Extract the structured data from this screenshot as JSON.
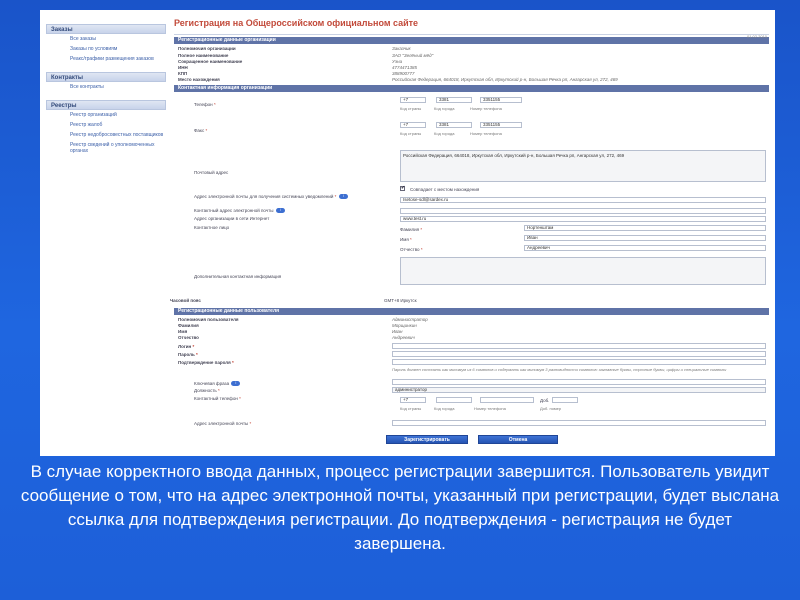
{
  "sidebar": {
    "sections": [
      {
        "title": "Заказы",
        "items": [
          "Все заказы",
          "Заказы по условиям",
          "Реакс/графики размещения заказов"
        ]
      },
      {
        "title": "Контракты",
        "items": [
          "Все контракты"
        ]
      },
      {
        "title": "Реестры",
        "items": [
          "Реестр организаций",
          "Реестр жалоб",
          "Реестр недобросовестных поставщиков",
          "Реестр сведений о уполномоченных органах"
        ]
      }
    ]
  },
  "page": {
    "title": "Регистрация на Общероссийском официальном сайте",
    "date": "01.02.2010"
  },
  "org_section": {
    "header": "Регистрационные данные организации",
    "rows": [
      {
        "label": "Полномочия организации",
        "value": "Заказчик"
      },
      {
        "label": "Полное наименование",
        "value": "ЗАО \"Зелёный мёд\""
      },
      {
        "label": "Сокращенное наименование",
        "value": "Уэна"
      },
      {
        "label": "ИНН",
        "value": "4774471385"
      },
      {
        "label": "КПП",
        "value": "388900777"
      },
      {
        "label": "Место нахождения",
        "value": "Российская Федерация, 664018, Иркутская обл, Иркутский р-н, Большая Речка рп, Ангарская ул, 272, 469"
      }
    ]
  },
  "contact_section": {
    "header": "Контактная информация организации",
    "phone_label": "Телефон",
    "fax_label": "Факс",
    "phone": {
      "country": "+7",
      "city": "3381",
      "number": "3351155"
    },
    "fax": {
      "country": "+7",
      "city": "3381",
      "number": "3351155"
    },
    "caps": {
      "country": "Код страны",
      "city": "Код города",
      "number": "Номер телефона"
    },
    "postal_label": "Почтовый адрес",
    "postal_value": "Российская Федерация, 664018, Иркутская обл, Иркутский р-н, Большая Речка рп, Ангарская ул, 272, 469",
    "same_as_location": "Совпадает с местом нахождения",
    "email_notify_label": "Адрес электронной почты для получения системных уведомлений",
    "email_notify_value": "Isetose-sdl@sardex.ru",
    "contact_email_label": "Контактный адрес электронной почты",
    "website_label": "Адрес организации в сети Интернет",
    "website_value": "www.test.ru",
    "contact_person_label": "Контактное лицо",
    "surname_label": "Фамилия",
    "surname_value": "Нортенштам",
    "name_label": "Имя",
    "name_value": "Иван",
    "patronymic_label": "Отчество",
    "patronymic_value": "Андреевич",
    "extra_label": "Дополнительная контактная информация",
    "timezone_label": "Часовой пояс",
    "timezone_value": "GMT+8 Иркутск"
  },
  "user_section": {
    "header": "Регистрационные данные пользователя",
    "rows": [
      {
        "label": "Полномочия пользователя",
        "value": "Администратор"
      },
      {
        "label": "Фамилия",
        "value": "Морщинкин"
      },
      {
        "label": "Имя",
        "value": "Иван"
      },
      {
        "label": "Отчество",
        "value": "Андреевич"
      }
    ],
    "login_label": "Логин",
    "password_label": "Пароль",
    "confirm_label": "Подтверждение пароля",
    "password_hint": "Пароль должен состоять как минимум из 6 символов и содержать как минимум 3 разновидности символов: заглавные буквы, строчные буквы, цифры и специальные символы",
    "keyword_label": "Ключевая фраза",
    "position_label": "Должность",
    "position_value": "администратор",
    "phone_label": "Контактный телефон",
    "phone_country": "+7",
    "ext_prefix": "Доб.",
    "ext_cap": "Доб. номер",
    "email_label": "Адрес электронной почты"
  },
  "buttons": {
    "register": "Зарегистрировать",
    "cancel": "Отмена"
  },
  "caption": "В случае корректного ввода данных, процесс регистрации завершится. Пользователь увидит сообщение о том, что на адрес электронной почты, указанный при регистрации, будет выслана ссылка для подтверждения регистрации. До подтверждения - регистрация не будет завершена.",
  "colors": {
    "background": "#1f60d9",
    "section_header": "#5f73a7",
    "title": "#c24a3a",
    "button": "#2f63c6"
  }
}
